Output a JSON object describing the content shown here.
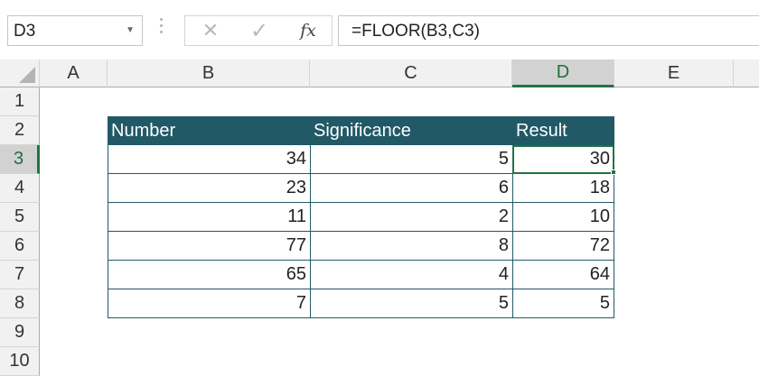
{
  "name_box": {
    "value": "D3"
  },
  "formula_bar": {
    "cancel_symbol": "✕",
    "enter_symbol": "✓",
    "fx_label": "fx",
    "formula": "=FLOOR(B3,C3)"
  },
  "columns": [
    "A",
    "B",
    "C",
    "D",
    "E"
  ],
  "selected_column": "D",
  "rows": [
    "1",
    "2",
    "3",
    "4",
    "5",
    "6",
    "7",
    "8",
    "9",
    "10"
  ],
  "selected_row": "3",
  "table": {
    "headers": [
      "Number",
      "Significance",
      "Result"
    ],
    "rows": [
      [
        "34",
        "5",
        "30"
      ],
      [
        "23",
        "6",
        "18"
      ],
      [
        "11",
        "2",
        "10"
      ],
      [
        "77",
        "8",
        "72"
      ],
      [
        "65",
        "4",
        "64"
      ],
      [
        "7",
        "5",
        "5"
      ]
    ]
  },
  "colors": {
    "header_fill": "#215967",
    "selection": "#217346"
  }
}
